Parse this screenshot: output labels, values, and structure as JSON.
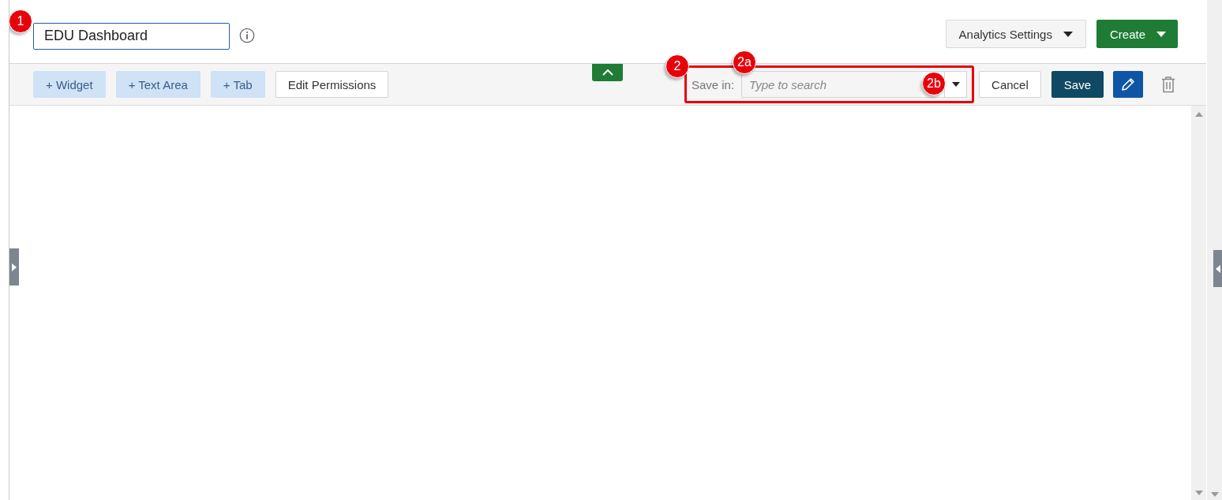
{
  "header": {
    "title_field": {
      "value": "EDU Dashboard",
      "callout": "1"
    },
    "buttons": [
      {
        "kind": "dropdown",
        "label": "Analytics Settings"
      },
      {
        "kind": "primary-dropdown",
        "label": "Create"
      }
    ]
  },
  "toolbar": {
    "add_buttons": [
      {
        "label": "+ Widget",
        "kind": "light"
      },
      {
        "label": "+ Text Area",
        "kind": "light"
      },
      {
        "label": "+ Tab",
        "kind": "light"
      },
      {
        "label": "Edit Permissions",
        "kind": "outline"
      }
    ],
    "collapse_tab": {
      "expanded": true
    },
    "save_in": {
      "label": "Save in:",
      "placeholder": "Type to search",
      "highlighted": true,
      "callout": "2",
      "field_callout": "2a",
      "dropdown_callout": "2b"
    },
    "actions": [
      {
        "kind": "outline",
        "label": "Cancel"
      },
      {
        "kind": "dark",
        "label": "Save"
      },
      {
        "kind": "edit-icon"
      },
      {
        "kind": "delete-icon"
      }
    ]
  }
}
